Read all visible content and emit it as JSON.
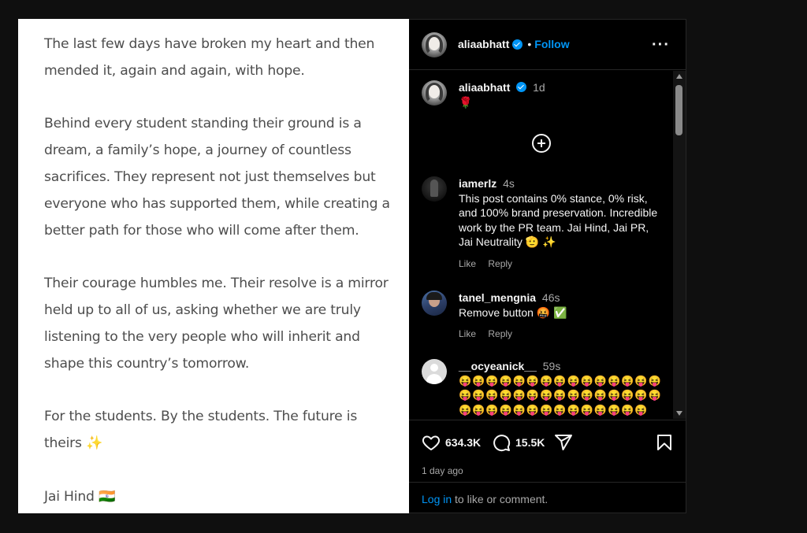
{
  "post": {
    "partial_top_line": "",
    "paragraphs": [
      "The last few days have broken my heart and then mended it, again and again, with hope.",
      "Behind every student standing their ground is a dream, a family’s hope, a journey of countless sacrifices. They represent not just themselves but everyone who has supported them, while creating a better path for those who will come after them.",
      "Their courage humbles me. Their resolve is a mirror held up to all of us, asking whether we are truly listening to the very people who will inherit and shape this country’s tomorrow.",
      "For the students. By the students. The future is theirs ✨",
      "Jai Hind 🇮🇳"
    ]
  },
  "header": {
    "username": "aliaabhatt",
    "separator": "•",
    "follow_label": "Follow",
    "more_label": "···"
  },
  "caption": {
    "username": "aliaabhatt",
    "time": "1d",
    "text": "🌹"
  },
  "comments": [
    {
      "username": "iamerlz",
      "time": "4s",
      "text": "This post contains 0% stance, 0% risk, and 100% brand preservation. Incredible work by the PR team. Jai Hind, Jai PR, Jai Neutrality 🫡 ✨",
      "like_label": "Like",
      "reply_label": "Reply"
    },
    {
      "username": "tanel_mengnia",
      "time": "46s",
      "text": "Remove button 🤬 ✅",
      "like_label": "Like",
      "reply_label": "Reply"
    },
    {
      "username": "__ocyeanick__",
      "time": "59s",
      "text": "😝😝😝😝😝😝😝😝😝😝😝😝😝😝😝😝😝😝😝😝😝😝😝😝😝😝😝😝😝😝😝😝😝😝😝😝😝😝😝😝😝😝😝😝"
    }
  ],
  "actions": {
    "likes": "634.3K",
    "comments": "15.5K"
  },
  "timestamp": "1 day ago",
  "login": {
    "link": "Log in",
    "rest": " to like or comment."
  },
  "colors": {
    "accent": "#0095f6",
    "background": "#000000",
    "post_text": "#4d4d4d"
  }
}
